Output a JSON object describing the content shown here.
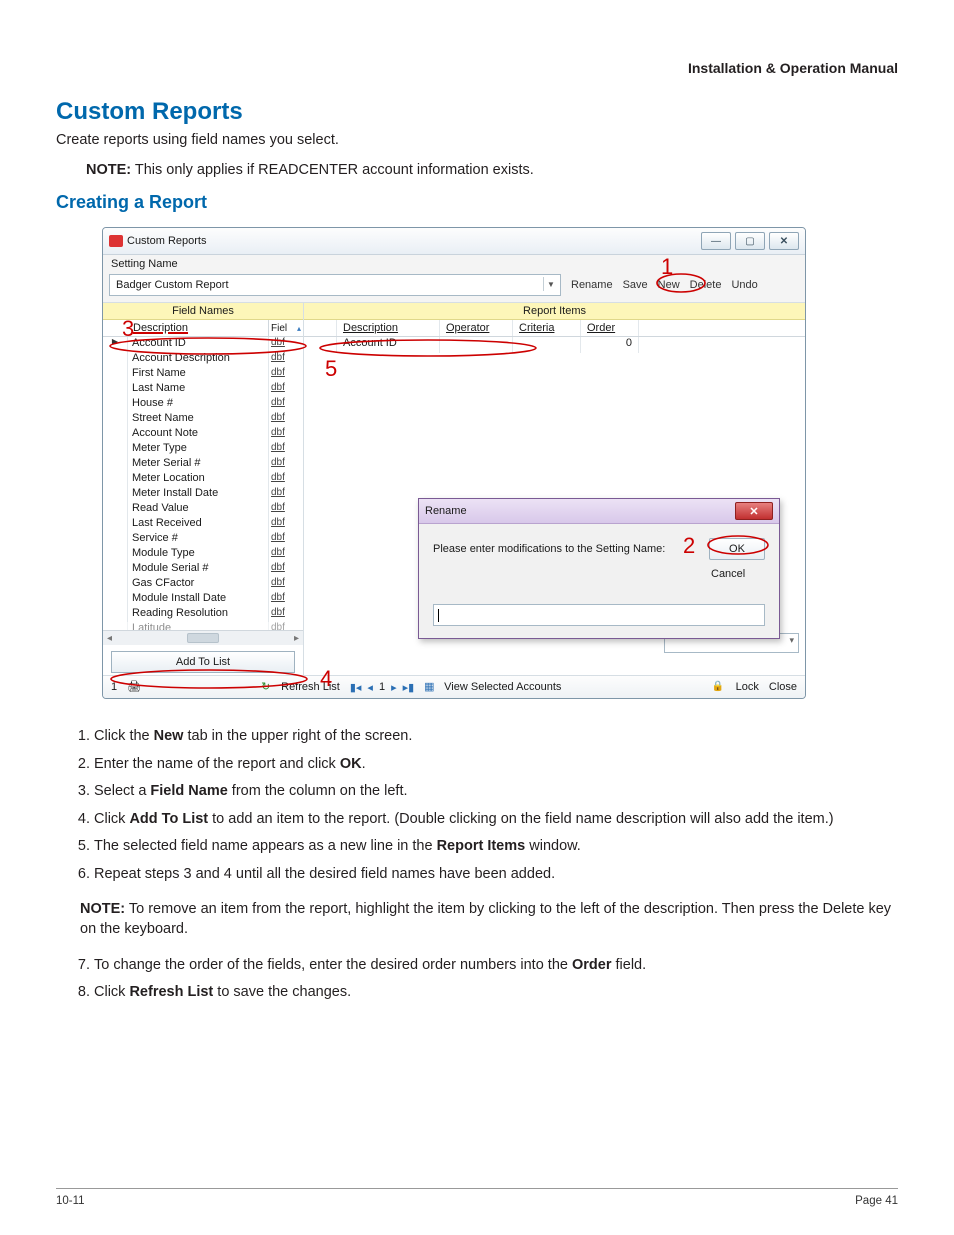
{
  "doc": {
    "header": "Installation & Operation Manual",
    "section_title": "Custom Reports",
    "intro": "Create reports using field names you select.",
    "note_label": "NOTE:",
    "note_text": " This only applies if READCENTER account information exists.",
    "subsection": "Creating a Report"
  },
  "window": {
    "title": "Custom Reports",
    "setting_label": "Setting Name",
    "combo_value": "Badger Custom Report",
    "tools": {
      "rename": "Rename",
      "save": "Save",
      "new_": "New",
      "delete_": "Delete",
      "undo": "Undo"
    },
    "winbtns": {
      "min": "—",
      "max": "▢",
      "close": "✕"
    }
  },
  "left": {
    "heading": "Field Names",
    "desc_col": "Description",
    "fiel_col": "Fiel",
    "rows": [
      {
        "d": "Account ID",
        "t": "dbf"
      },
      {
        "d": "Account Description",
        "t": "dbf"
      },
      {
        "d": "First Name",
        "t": "dbf"
      },
      {
        "d": "Last Name",
        "t": "dbf"
      },
      {
        "d": "House #",
        "t": "dbf"
      },
      {
        "d": "Street Name",
        "t": "dbf"
      },
      {
        "d": "Account Note",
        "t": "dbf"
      },
      {
        "d": "Meter Type",
        "t": "dbf"
      },
      {
        "d": "Meter Serial #",
        "t": "dbf"
      },
      {
        "d": "Meter Location",
        "t": "dbf"
      },
      {
        "d": "Meter Install Date",
        "t": "dbf"
      },
      {
        "d": "Read Value",
        "t": "dbf"
      },
      {
        "d": "Last Received",
        "t": "dbf"
      },
      {
        "d": "Service #",
        "t": "dbf"
      },
      {
        "d": "Module Type",
        "t": "dbf"
      },
      {
        "d": "Module Serial #",
        "t": "dbf"
      },
      {
        "d": "Gas CFactor",
        "t": "dbf"
      },
      {
        "d": "Module Install Date",
        "t": "dbf"
      },
      {
        "d": "Reading Resolution",
        "t": "dbf"
      },
      {
        "d": "Latitude",
        "t": "dbf"
      }
    ],
    "hscroll_marker": "⟨  Ⅲ                             ▸",
    "add_to_list": "Add To List"
  },
  "right": {
    "heading": "Report Items",
    "cols": {
      "desc": "Description",
      "op": "Operator",
      "crit": "Criteria",
      "order": "Order"
    },
    "row0": {
      "desc": "Account ID",
      "op": "",
      "crit": "",
      "order": "0"
    }
  },
  "dialog": {
    "title": "Rename",
    "prompt": "Please enter modifications to the Setting Name:",
    "ok": "OK",
    "cancel": "Cancel"
  },
  "status": {
    "page_num": "1",
    "refresh": "Refresh List",
    "pager": "1",
    "view": "View Selected Accounts",
    "lock": "Lock",
    "close": "Close"
  },
  "callouts": {
    "c1": "1",
    "c2": "2",
    "c3": "3",
    "c4": "4",
    "c5": "5"
  },
  "steps1": [
    "Click the <b>New</b> tab in the upper right of the screen.",
    "Enter the name of the report and click <b>OK</b>.",
    "Select a <b>Field Name</b> from the column on the left.",
    "Click <b>Add To List</b> to add an item to the report. (Double clicking on the field name description will also add the item.)",
    "The selected field name appears as a new line in the <b>Report Items</b> window.",
    "Repeat steps 3 and 4 until all the desired field names have been added."
  ],
  "note2_label": "NOTE:",
  "note2_text": "  To remove an item from the report, highlight the item by clicking to the left of the description. Then press the Delete key on the keyboard.",
  "steps2": [
    "To change the order of the fields, enter the desired order numbers into the <b>Order</b> field.",
    "Click <b>Refresh List</b> to save the changes."
  ],
  "footer": {
    "left": "10-11",
    "right": "Page 41"
  }
}
